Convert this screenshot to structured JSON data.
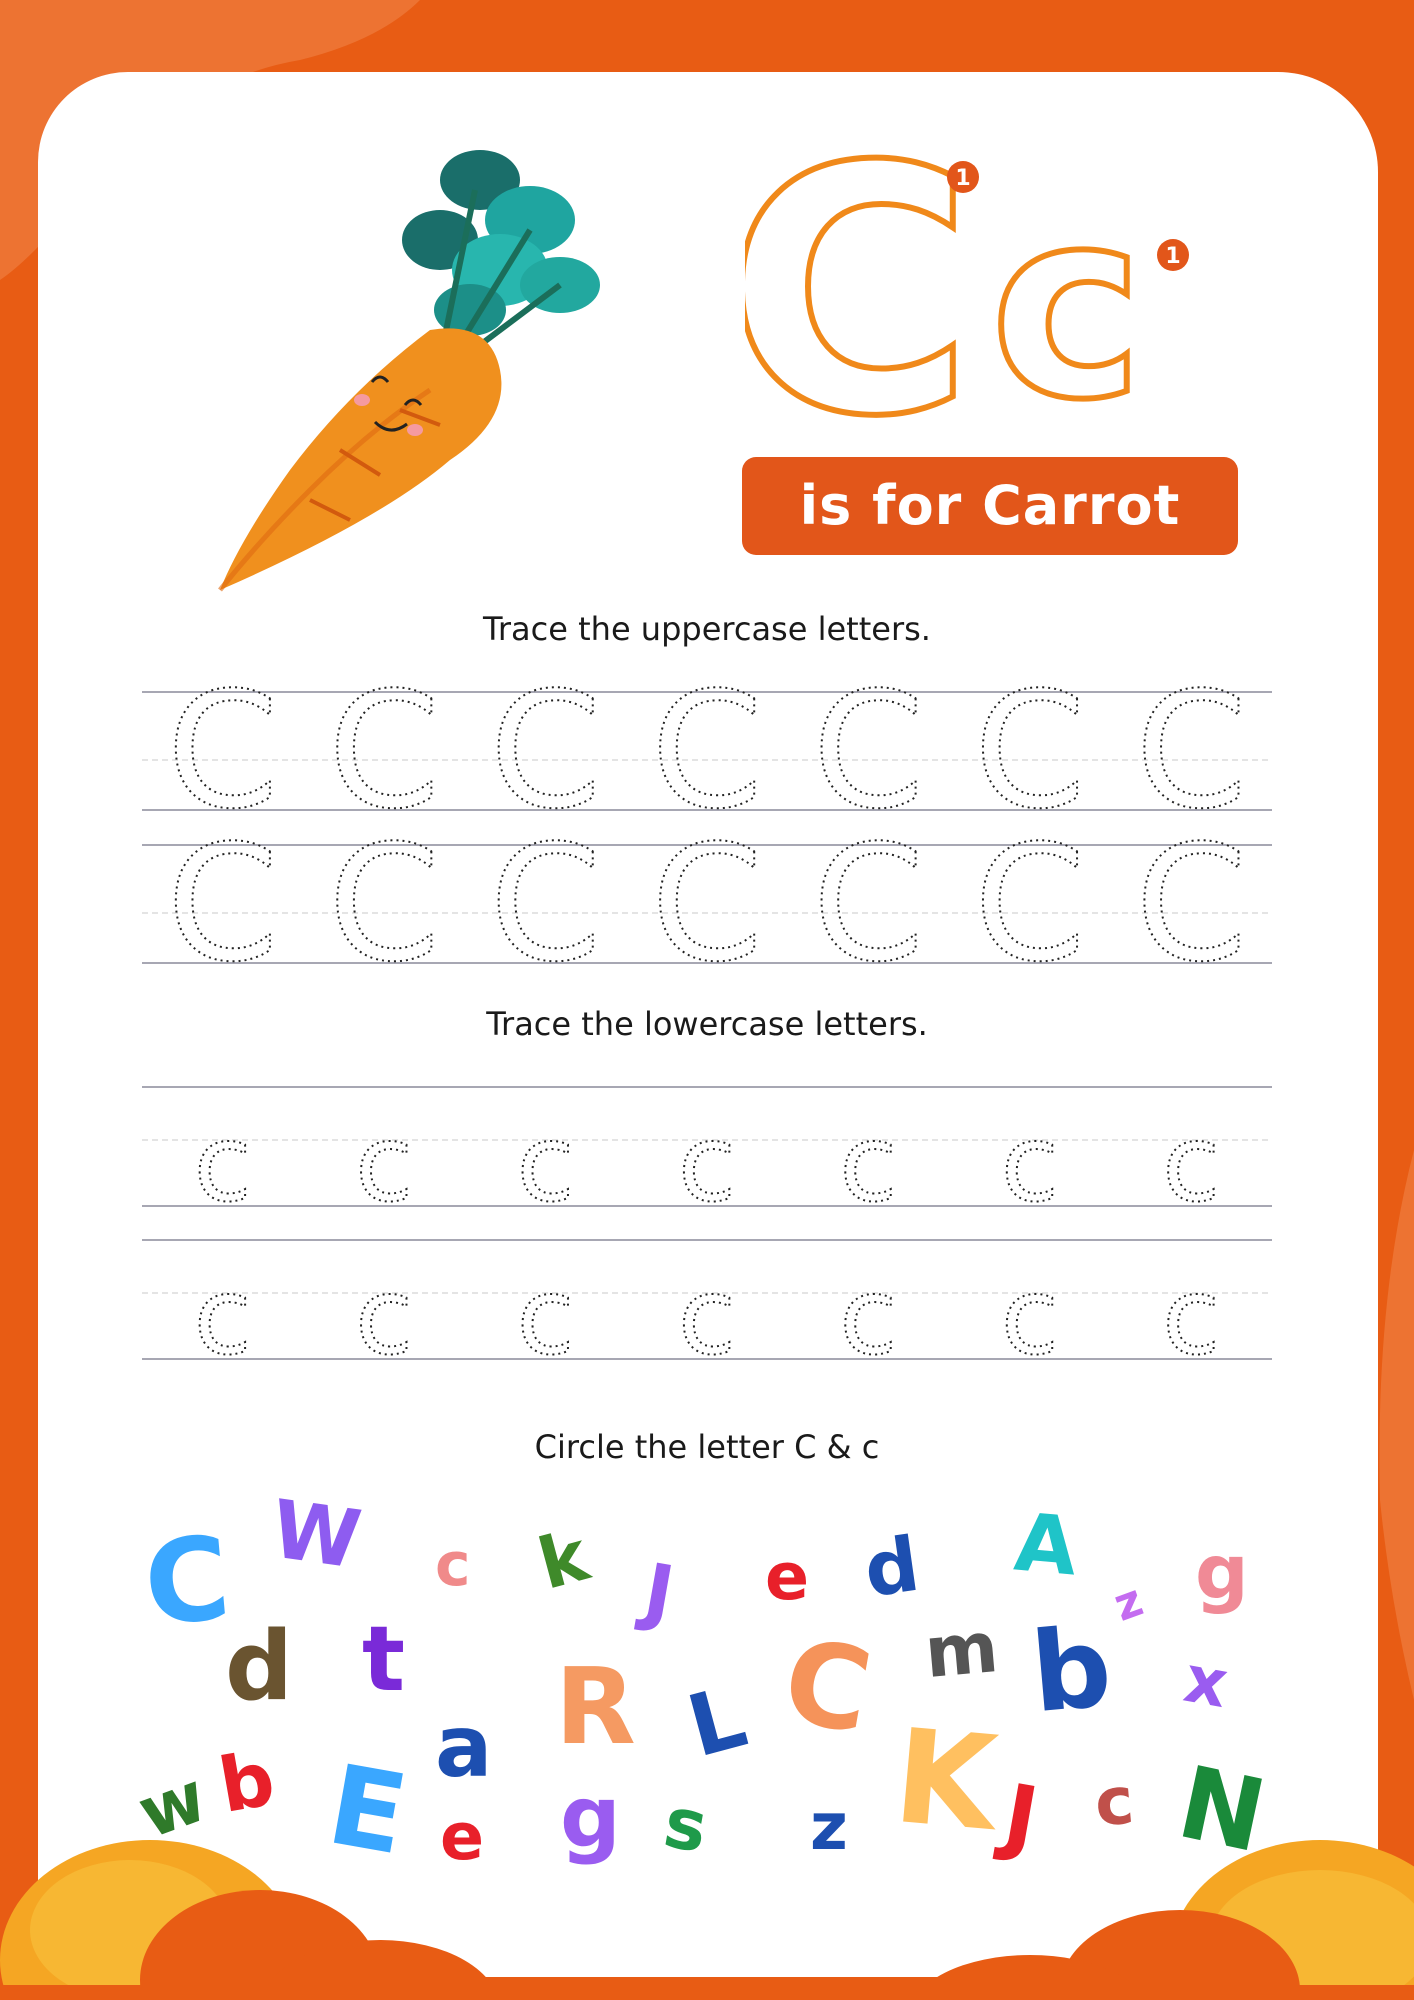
{
  "title": {
    "tagline": "is for Carrot"
  },
  "hero": {
    "big_upper": "C",
    "big_lower": "c",
    "stroke_number": "1"
  },
  "sections": {
    "uppercase_instruction": "Trace the uppercase letters.",
    "lowercase_instruction": "Trace the lowercase letters.",
    "circle_instruction": "Circle the letter C & c"
  },
  "tracing": {
    "upper_letter": "C",
    "lower_letter": "c",
    "per_row": 7
  },
  "colors": {
    "frame_orange": "#e85c14",
    "banner_orange": "#e2561a",
    "outline_orange": "#f0891a",
    "guide_gray": "#8a8a9a"
  },
  "letters_pool": [
    {
      "char": "C",
      "color": "#3aa7ff"
    },
    {
      "char": "W",
      "color": "#8e5cf0"
    },
    {
      "char": "c",
      "color": "#f08a8a"
    },
    {
      "char": "k",
      "color": "#3f8a2a"
    },
    {
      "char": "J",
      "color": "#9a5cf0"
    },
    {
      "char": "e",
      "color": "#e8202a"
    },
    {
      "char": "d",
      "color": "#1d4fb0"
    },
    {
      "char": "A",
      "color": "#1fc4c8"
    },
    {
      "char": "z",
      "color": "#c46cf0"
    },
    {
      "char": "g",
      "color": "#f08a96"
    },
    {
      "char": "d",
      "color": "#6a5430"
    },
    {
      "char": "t",
      "color": "#7a2ad8"
    },
    {
      "char": "a",
      "color": "#1d4fb0"
    },
    {
      "char": "R",
      "color": "#f59a62"
    },
    {
      "char": "L",
      "color": "#1d4fb0"
    },
    {
      "char": "C",
      "color": "#f5935a"
    },
    {
      "char": "m",
      "color": "#555555"
    },
    {
      "char": "b",
      "color": "#1d4fb0"
    },
    {
      "char": "x",
      "color": "#9a5cf0"
    },
    {
      "char": "w",
      "color": "#2f7a2a"
    },
    {
      "char": "b",
      "color": "#e8202a"
    },
    {
      "char": "E",
      "color": "#3aa7ff"
    },
    {
      "char": "e",
      "color": "#e8202a"
    },
    {
      "char": "g",
      "color": "#9a5cf0"
    },
    {
      "char": "s",
      "color": "#1f9a4a"
    },
    {
      "char": "z",
      "color": "#1d4fb0"
    },
    {
      "char": "K",
      "color": "#ffc060"
    },
    {
      "char": "J",
      "color": "#e8202a"
    },
    {
      "char": "c",
      "color": "#c0504a"
    },
    {
      "char": "N",
      "color": "#1a8a3a"
    }
  ]
}
